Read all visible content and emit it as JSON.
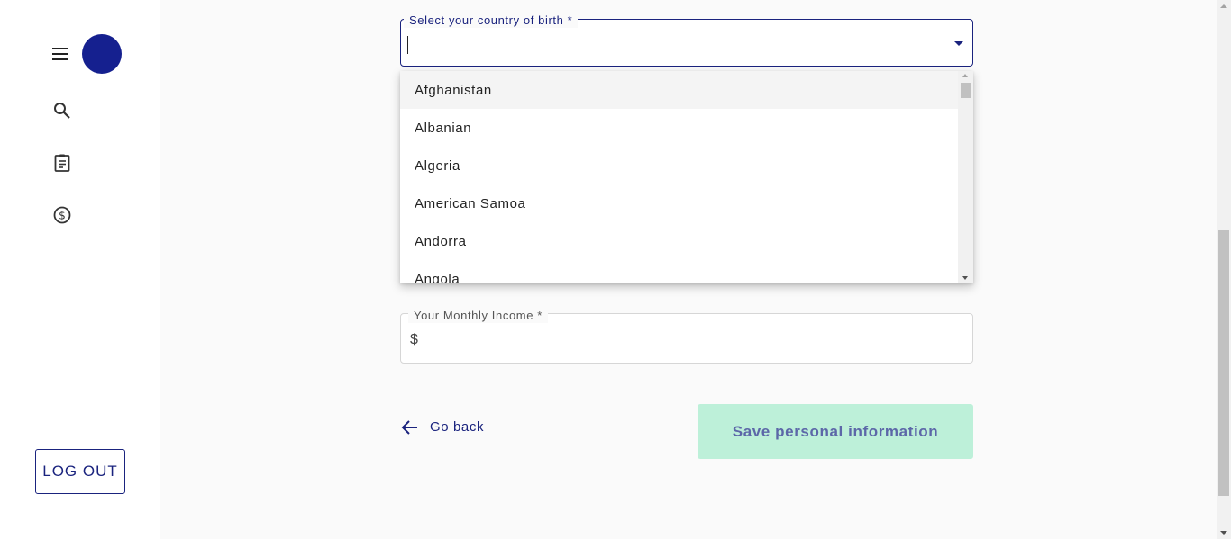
{
  "sidebar": {
    "menu_icon": "hamburger-menu-icon",
    "avatar_color": "#15208f",
    "nav_icons": [
      "search-icon",
      "clipboard-icon",
      "dollar-circle-icon"
    ],
    "logout_label": "LOG OUT"
  },
  "form": {
    "country": {
      "label": "Select your country of birth *",
      "value": "",
      "options": [
        "Afghanistan",
        "Albanian",
        "Algeria",
        "American Samoa",
        "Andorra",
        "Angola"
      ],
      "highlighted": "Afghanistan"
    },
    "income": {
      "label": "Your Monthly Income *",
      "prefix": "$",
      "value": ""
    },
    "go_back_label": "Go back",
    "save_label": "Save personal information"
  },
  "colors": {
    "accent": "#1a237e",
    "save_button_bg": "#bdf0d9",
    "save_button_text": "#5c67a8"
  }
}
